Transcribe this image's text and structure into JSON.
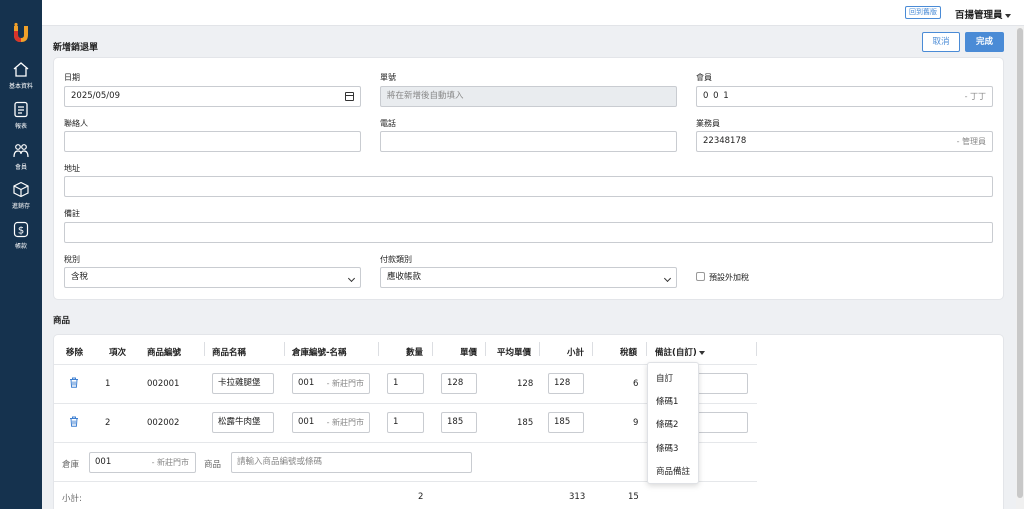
{
  "topbar": {
    "back_old": "回到舊版",
    "user": "百揚管理員"
  },
  "sidebar": {
    "items": [
      {
        "label": "基本資料",
        "icon": "home-icon"
      },
      {
        "label": "報表",
        "icon": "report-icon"
      },
      {
        "label": "會員",
        "icon": "members-icon"
      },
      {
        "label": "進銷存",
        "icon": "inventory-box-icon"
      },
      {
        "label": "帳款",
        "icon": "dollar-icon"
      }
    ]
  },
  "page": {
    "title": "新增銷退單",
    "cancel": "取消",
    "done": "完成"
  },
  "form": {
    "date": {
      "label": "日期",
      "value": "2025/05/09"
    },
    "order_no": {
      "label": "單號",
      "placeholder": "將在新增後自動填入"
    },
    "member": {
      "label": "會員",
      "value": "0 0 1",
      "suffix": "- 丁丁"
    },
    "contact": {
      "label": "聯絡人",
      "value": ""
    },
    "phone": {
      "label": "電話",
      "value": ""
    },
    "salesperson": {
      "label": "業務員",
      "value": "22348178",
      "suffix": "- 管理員"
    },
    "address": {
      "label": "地址",
      "value": ""
    },
    "note": {
      "label": "備註",
      "value": ""
    },
    "tax_type": {
      "label": "稅別",
      "value": "含稅"
    },
    "payment_type": {
      "label": "付款類別",
      "value": "應收帳款"
    },
    "extra_tax": {
      "label": "預設外加稅"
    }
  },
  "items": {
    "title": "商品",
    "headers": {
      "remove": "移除",
      "index": "項次",
      "code": "商品編號",
      "name": "商品名稱",
      "warehouse": "倉庫編號-名稱",
      "qty": "數量",
      "price": "單價",
      "avg_price": "平均單價",
      "subtotal": "小計",
      "tax": "稅額",
      "note": "備註(自訂)"
    },
    "rows": [
      {
        "index": "1",
        "code": "002001",
        "name": "卡拉雞腿堡",
        "warehouse_code": "001",
        "warehouse_name": "- 新莊門市",
        "qty": "1",
        "price": "128",
        "avg_price": "128",
        "subtotal": "128",
        "tax": "6"
      },
      {
        "index": "2",
        "code": "002002",
        "name": "松露牛肉堡",
        "warehouse_code": "001",
        "warehouse_name": "- 新莊門市",
        "qty": "1",
        "price": "185",
        "avg_price": "185",
        "subtotal": "185",
        "tax": "9"
      }
    ],
    "add_row": {
      "warehouse_label": "倉庫",
      "warehouse_code": "001",
      "warehouse_name": "- 新莊門市",
      "product_label": "商品",
      "product_placeholder": "請輸入商品編號或條碼"
    },
    "totals": {
      "label": "小計:",
      "qty": "2",
      "subtotal": "313",
      "tax": "15"
    },
    "note_menu": [
      "自訂",
      "條碼1",
      "條碼2",
      "條碼3",
      "商品備註"
    ]
  }
}
